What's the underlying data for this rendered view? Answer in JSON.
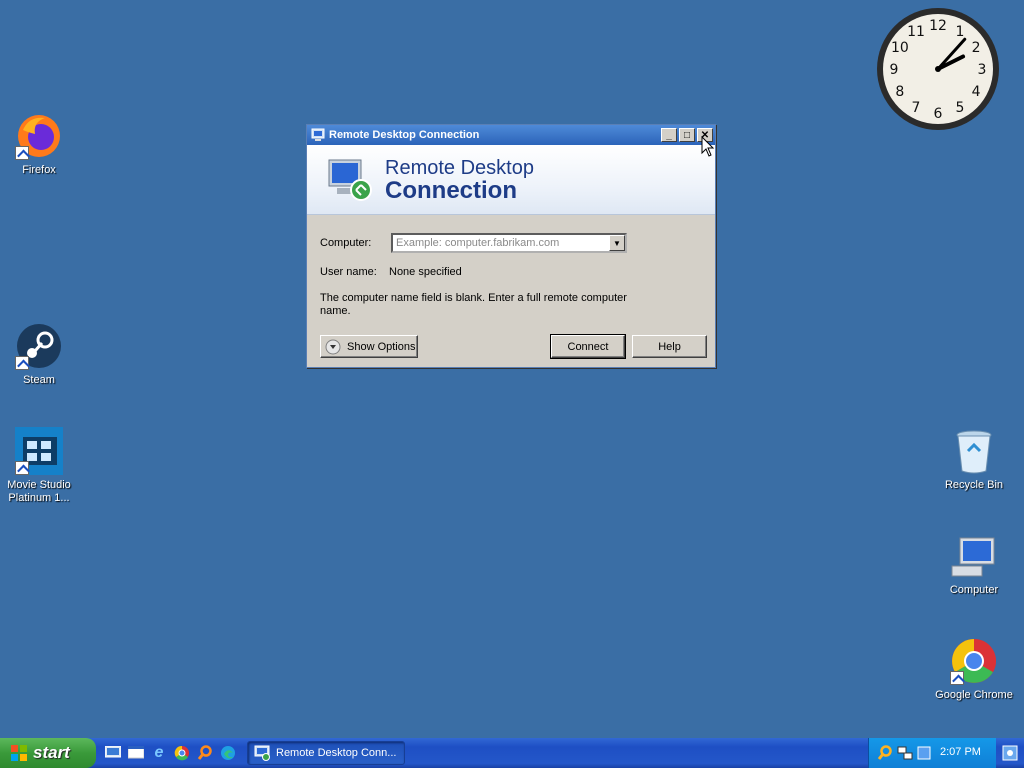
{
  "desktop": {
    "icons": [
      {
        "label": "Firefox"
      },
      {
        "label": "Steam"
      },
      {
        "label": "Movie Studio Platinum 1..."
      },
      {
        "label": "Recycle Bin"
      },
      {
        "label": "Computer"
      },
      {
        "label": "Google Chrome"
      }
    ]
  },
  "clock": {
    "numerals": [
      "12",
      "1",
      "2",
      "3",
      "4",
      "5",
      "6",
      "7",
      "8",
      "9",
      "10",
      "11"
    ],
    "hour": 2,
    "minute": 7
  },
  "dialog": {
    "title": "Remote Desktop Connection",
    "banner_line1": "Remote Desktop",
    "banner_line2": "Connection",
    "computer_label": "Computer:",
    "computer_value": "",
    "computer_placeholder": "Example: computer.fabrikam.com",
    "username_label": "User name:",
    "username_value": "None specified",
    "message": "The computer name field is blank. Enter a full remote computer name.",
    "show_options": "Show Options",
    "connect": "Connect",
    "help": "Help"
  },
  "taskbar": {
    "start_label": "start",
    "task_label": "Remote Desktop Conn...",
    "time": "2:07 PM"
  }
}
